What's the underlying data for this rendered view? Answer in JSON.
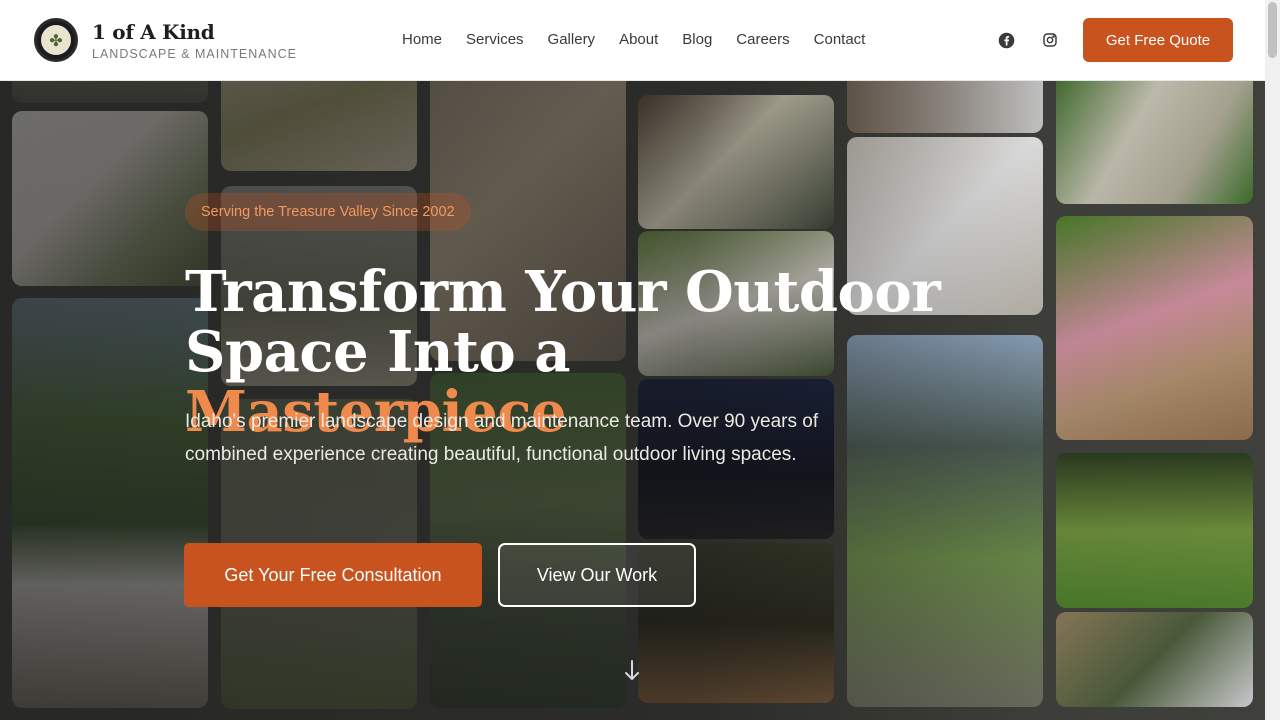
{
  "brand": {
    "name": "1 of A Kind",
    "tagline": "LANDSCAPE & MAINTENANCE",
    "logo_icon": "logo-icon"
  },
  "nav": {
    "items": [
      {
        "label": "Home"
      },
      {
        "label": "Services"
      },
      {
        "label": "Gallery"
      },
      {
        "label": "About"
      },
      {
        "label": "Blog"
      },
      {
        "label": "Careers"
      },
      {
        "label": "Contact"
      }
    ]
  },
  "social": {
    "facebook_icon": "facebook-icon",
    "instagram_icon": "instagram-icon"
  },
  "header_cta": {
    "label": "Get Free Quote"
  },
  "hero": {
    "badge": "Serving the Treasure Valley Since 2002",
    "headline_line1": "Transform Your Outdoor",
    "headline_line2_prefix": "Space Into a ",
    "headline_accent": "Masterpiece",
    "subtext": "Idaho's premier landscape design and maintenance team. Over 90 years of combined experience creating beautiful, functional outdoor living spaces.",
    "primary_cta": "Get Your Free Consultation",
    "secondary_cta": "View Our Work",
    "scroll_icon": "arrow-down-icon"
  },
  "colors": {
    "accent": "#c8531f",
    "accent_light": "#ef8a4c",
    "header_bg": "#ffffff"
  }
}
